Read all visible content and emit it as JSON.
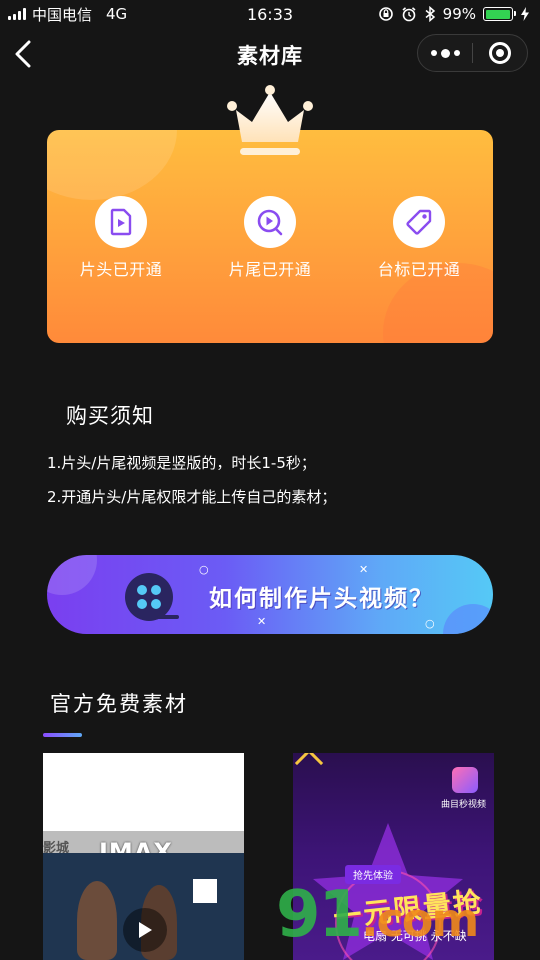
{
  "status_bar": {
    "carrier": "中国电信",
    "network": "4G",
    "time": "16:33",
    "battery": "99%",
    "battery_level": 0.99
  },
  "nav": {
    "title": "素材库",
    "back_icon": "chevron-left-icon",
    "more_icon": "more-dots-icon",
    "close_icon": "target-circle-icon"
  },
  "vip_card": {
    "crown_icon": "crown-icon",
    "perks": [
      {
        "label": "片头已开通",
        "icon": "document-play-icon"
      },
      {
        "label": "片尾已开通",
        "icon": "video-play-icon"
      },
      {
        "label": "台标已开通",
        "icon": "tag-icon"
      }
    ]
  },
  "notice": {
    "title": "购买须知",
    "lines": [
      "1.片头/片尾视频是竖版的，时长1-5秒；",
      "2.开通片头/片尾权限才能上传自己的素材；"
    ]
  },
  "banner": {
    "text": "如何制作片头视频？",
    "icon": "film-reel-icon"
  },
  "free_materials": {
    "title": "官方免费素材",
    "thumbnails": [
      {
        "imax": "IMAX",
        "shop": "影城",
        "play_icon": "play-icon"
      },
      {
        "tag": "抢先体验",
        "promo": "一元限量抢",
        "promo_sub": "电扇 无可挑 永不缺",
        "logo_text": "曲目秒视频"
      }
    ]
  },
  "watermark": {
    "digits": "91",
    "suffix": ".com"
  },
  "colors": {
    "background": "#151515",
    "card_orange": "#ffa13c",
    "banner_purple": "#7a3ff0",
    "banner_blue": "#55c9f6",
    "icon_purple": "#8a4cf0"
  }
}
